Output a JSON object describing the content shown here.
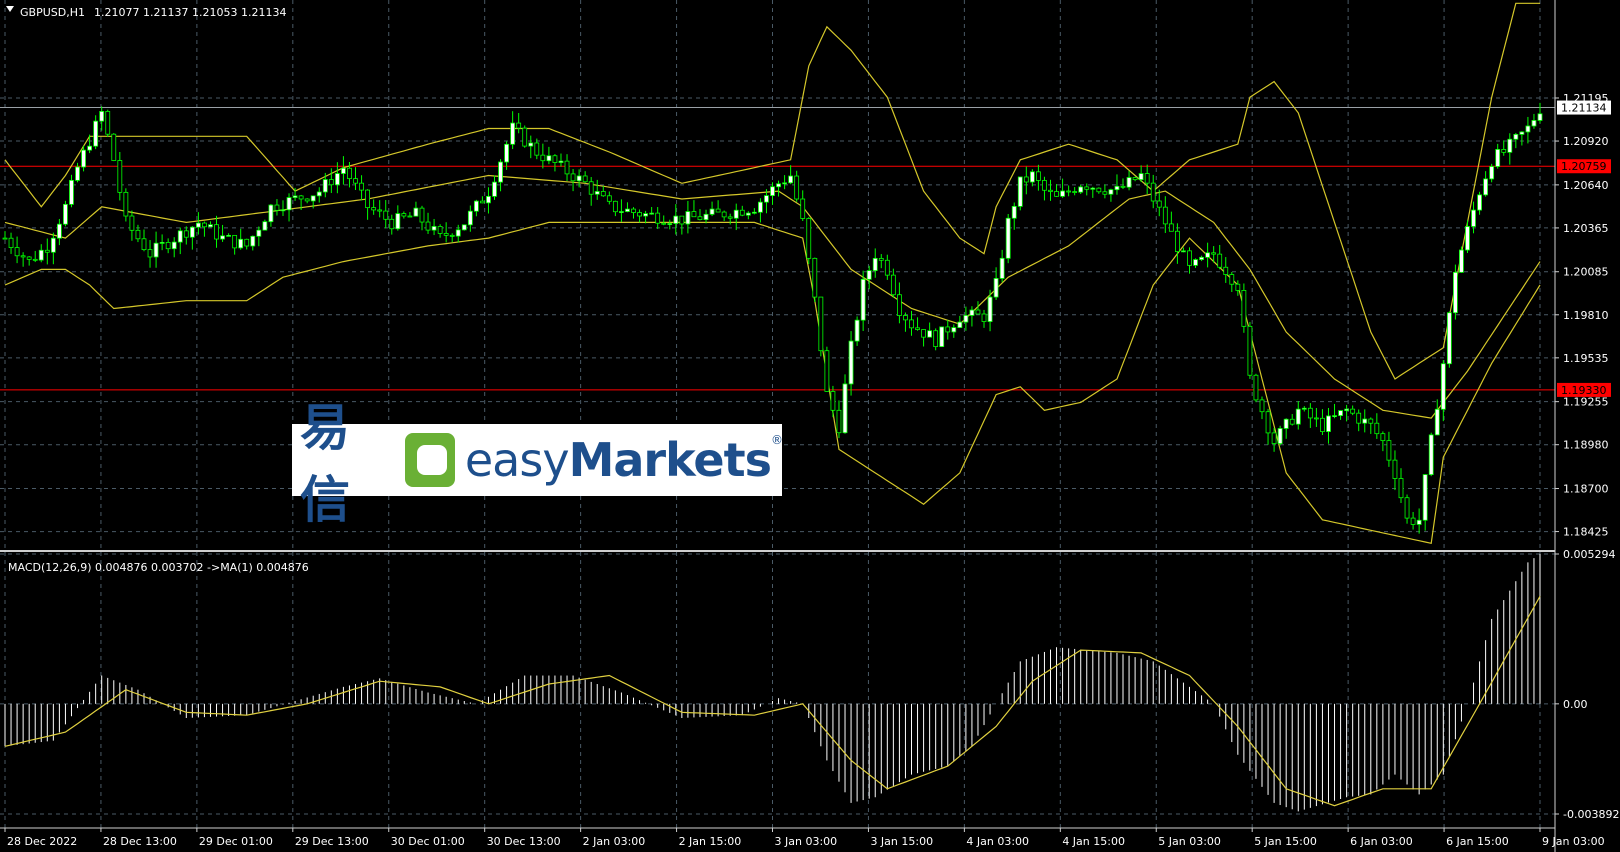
{
  "header": {
    "symbol": "GBPUSD,H1",
    "ohlc": "1.21077 1.21137 1.21053 1.21134"
  },
  "macd_header": "MACD(12,26,9) 0.004876 0.003702  ->MA(1) 0.004876",
  "logo": {
    "cn": "易信",
    "en_light": "easy",
    "en_bold": "Markets",
    "reg": "®"
  },
  "colors": {
    "background": "#000000",
    "grid": "#4a5a66",
    "bull_candle": "#ffffff",
    "bear_candle": "#000000",
    "wick": "#00ff00",
    "bands": "#d4c72a",
    "level_line": "#ff0000",
    "macd_hist": "#ffffff",
    "macd_signal": "#e0d040",
    "text": "#ffffff"
  },
  "chart_data": [
    {
      "type": "candlestick",
      "symbol": "GBPUSD",
      "timeframe": "H1",
      "ylim": [
        1.1832,
        1.2177
      ],
      "yticks": [
        "1.21195",
        "1.20920",
        "1.20640",
        "1.20365",
        "1.20085",
        "1.19810",
        "1.19535",
        "1.19255",
        "1.18980",
        "1.18700",
        "1.18425"
      ],
      "current_price": "1.21134",
      "levels": [
        {
          "value": 1.20759,
          "label": "1.20759"
        },
        {
          "value": 1.1933,
          "label": "1.19330"
        }
      ],
      "x_labels": [
        "28 Dec 2022",
        "28 Dec 13:00",
        "29 Dec 01:00",
        "29 Dec 13:00",
        "30 Dec 01:00",
        "30 Dec 13:00",
        "2 Jan 03:00",
        "2 Jan 15:00",
        "3 Jan 03:00",
        "3 Jan 15:00",
        "4 Jan 03:00",
        "4 Jan 15:00",
        "5 Jan 03:00",
        "5 Jan 15:00",
        "6 Jan 03:00",
        "6 Jan 15:00",
        "9 Jan 03:00"
      ],
      "close_path": [
        [
          0,
          1.203
        ],
        [
          4,
          1.2015
        ],
        [
          7,
          1.2025
        ],
        [
          10,
          1.205
        ],
        [
          12,
          1.2075
        ],
        [
          16,
          1.211
        ],
        [
          18,
          1.208
        ],
        [
          20,
          1.204
        ],
        [
          24,
          1.202
        ],
        [
          28,
          1.203
        ],
        [
          32,
          1.204
        ],
        [
          36,
          1.203
        ],
        [
          40,
          1.2025
        ],
        [
          44,
          1.205
        ],
        [
          48,
          1.2055
        ],
        [
          52,
          1.206
        ],
        [
          56,
          1.2075
        ],
        [
          60,
          1.205
        ],
        [
          64,
          1.204
        ],
        [
          68,
          1.2045
        ],
        [
          72,
          1.203
        ],
        [
          76,
          1.204
        ],
        [
          80,
          1.206
        ],
        [
          84,
          1.21
        ],
        [
          88,
          1.2085
        ],
        [
          92,
          1.2075
        ],
        [
          96,
          1.2065
        ],
        [
          100,
          1.205
        ],
        [
          106,
          1.2045
        ],
        [
          112,
          1.2042
        ],
        [
          118,
          1.2045
        ],
        [
          124,
          1.205
        ],
        [
          128,
          1.2065
        ],
        [
          130,
          1.207
        ],
        [
          132,
          1.204
        ],
        [
          134,
          1.199
        ],
        [
          136,
          1.193
        ],
        [
          138,
          1.191
        ],
        [
          140,
          1.196
        ],
        [
          142,
          1.2
        ],
        [
          144,
          1.202
        ],
        [
          146,
          1.201
        ],
        [
          148,
          1.1985
        ],
        [
          150,
          1.1975
        ],
        [
          154,
          1.1965
        ],
        [
          158,
          1.198
        ],
        [
          162,
          1.198
        ],
        [
          164,
          1.2
        ],
        [
          166,
          1.204
        ],
        [
          168,
          1.2065
        ],
        [
          170,
          1.207
        ],
        [
          172,
          1.206
        ],
        [
          174,
          1.2055
        ],
        [
          178,
          1.2065
        ],
        [
          184,
          1.206
        ],
        [
          188,
          1.207
        ],
        [
          190,
          1.2055
        ],
        [
          192,
          1.204
        ],
        [
          196,
          1.201
        ],
        [
          200,
          1.202
        ],
        [
          204,
          1.2
        ],
        [
          206,
          1.194
        ],
        [
          208,
          1.192
        ],
        [
          210,
          1.19
        ],
        [
          214,
          1.192
        ],
        [
          218,
          1.191
        ],
        [
          222,
          1.192
        ],
        [
          226,
          1.191
        ],
        [
          228,
          1.19
        ],
        [
          230,
          1.188
        ],
        [
          232,
          1.185
        ],
        [
          234,
          1.185
        ],
        [
          236,
          1.19
        ],
        [
          238,
          1.195
        ],
        [
          240,
          1.201
        ],
        [
          244,
          1.206
        ],
        [
          246,
          1.208
        ],
        [
          248,
          1.2085
        ],
        [
          252,
          1.21
        ],
        [
          254,
          1.2113
        ]
      ],
      "bollinger_upper": [
        [
          0,
          1.208
        ],
        [
          6,
          1.205
        ],
        [
          10,
          1.207
        ],
        [
          14,
          1.2095
        ],
        [
          40,
          1.2095
        ],
        [
          48,
          1.206
        ],
        [
          56,
          1.2075
        ],
        [
          70,
          1.209
        ],
        [
          80,
          1.21
        ],
        [
          90,
          1.21
        ],
        [
          100,
          1.2085
        ],
        [
          112,
          1.2065
        ],
        [
          124,
          1.2075
        ],
        [
          130,
          1.208
        ],
        [
          133,
          1.214
        ],
        [
          136,
          1.2165
        ],
        [
          140,
          1.215
        ],
        [
          146,
          1.212
        ],
        [
          152,
          1.206
        ],
        [
          158,
          1.203
        ],
        [
          162,
          1.202
        ],
        [
          164,
          1.205
        ],
        [
          168,
          1.208
        ],
        [
          176,
          1.209
        ],
        [
          184,
          1.208
        ],
        [
          190,
          1.206
        ],
        [
          196,
          1.208
        ],
        [
          204,
          1.209
        ],
        [
          206,
          1.212
        ],
        [
          210,
          1.213
        ],
        [
          214,
          1.211
        ],
        [
          220,
          1.204
        ],
        [
          226,
          1.197
        ],
        [
          230,
          1.194
        ],
        [
          234,
          1.195
        ],
        [
          238,
          1.196
        ],
        [
          242,
          1.204
        ],
        [
          246,
          1.212
        ],
        [
          250,
          1.218
        ]
      ],
      "bollinger_middle": [
        [
          0,
          1.204
        ],
        [
          10,
          1.203
        ],
        [
          16,
          1.205
        ],
        [
          30,
          1.204
        ],
        [
          40,
          1.2045
        ],
        [
          60,
          1.2055
        ],
        [
          80,
          1.207
        ],
        [
          96,
          1.2065
        ],
        [
          112,
          1.2055
        ],
        [
          128,
          1.206
        ],
        [
          132,
          1.205
        ],
        [
          140,
          1.201
        ],
        [
          150,
          1.1985
        ],
        [
          158,
          1.1975
        ],
        [
          166,
          1.2005
        ],
        [
          176,
          1.2025
        ],
        [
          186,
          1.2055
        ],
        [
          192,
          1.206
        ],
        [
          200,
          1.204
        ],
        [
          206,
          1.201
        ],
        [
          212,
          1.197
        ],
        [
          220,
          1.194
        ],
        [
          228,
          1.192
        ],
        [
          236,
          1.1915
        ],
        [
          242,
          1.1945
        ],
        [
          254,
          1.2015
        ]
      ],
      "bollinger_lower": [
        [
          0,
          1.2
        ],
        [
          6,
          1.201
        ],
        [
          10,
          1.201
        ],
        [
          14,
          1.2
        ],
        [
          18,
          1.1985
        ],
        [
          30,
          1.199
        ],
        [
          40,
          1.199
        ],
        [
          46,
          1.2005
        ],
        [
          56,
          1.2015
        ],
        [
          70,
          1.2025
        ],
        [
          80,
          1.203
        ],
        [
          90,
          1.204
        ],
        [
          100,
          1.204
        ],
        [
          112,
          1.204
        ],
        [
          124,
          1.204
        ],
        [
          132,
          1.203
        ],
        [
          134,
          1.199
        ],
        [
          138,
          1.1895
        ],
        [
          146,
          1.1875
        ],
        [
          152,
          1.186
        ],
        [
          158,
          1.188
        ],
        [
          164,
          1.193
        ],
        [
          168,
          1.1935
        ],
        [
          172,
          1.192
        ],
        [
          178,
          1.1925
        ],
        [
          184,
          1.194
        ],
        [
          190,
          1.2
        ],
        [
          196,
          1.203
        ],
        [
          204,
          1.2
        ],
        [
          208,
          1.194
        ],
        [
          212,
          1.188
        ],
        [
          218,
          1.185
        ],
        [
          224,
          1.1845
        ],
        [
          230,
          1.184
        ],
        [
          236,
          1.1835
        ],
        [
          238,
          1.189
        ],
        [
          246,
          1.195
        ],
        [
          254,
          1.2
        ]
      ]
    },
    {
      "type": "bar",
      "name": "MACD(12,26,9)",
      "ylim": [
        -0.003892,
        0.005294
      ],
      "yticks": [
        "0.005294",
        "0.00",
        "-0.003892"
      ],
      "histogram_path": [
        [
          0,
          -0.0015
        ],
        [
          8,
          -0.0013
        ],
        [
          16,
          0.001
        ],
        [
          22,
          0.0005
        ],
        [
          30,
          -0.0005
        ],
        [
          40,
          -0.0004
        ],
        [
          48,
          0.0001
        ],
        [
          56,
          0.0006
        ],
        [
          62,
          0.0009
        ],
        [
          70,
          0.0004
        ],
        [
          78,
          0.0
        ],
        [
          86,
          0.001
        ],
        [
          94,
          0.001
        ],
        [
          102,
          0.0004
        ],
        [
          112,
          -0.0005
        ],
        [
          122,
          -0.0004
        ],
        [
          128,
          0.0002
        ],
        [
          132,
          0.0
        ],
        [
          136,
          -0.002
        ],
        [
          140,
          -0.0035
        ],
        [
          144,
          -0.0033
        ],
        [
          150,
          -0.0025
        ],
        [
          156,
          -0.0022
        ],
        [
          160,
          -0.0015
        ],
        [
          164,
          0.0
        ],
        [
          168,
          0.0015
        ],
        [
          174,
          0.002
        ],
        [
          184,
          0.0018
        ],
        [
          190,
          0.0015
        ],
        [
          196,
          0.0006
        ],
        [
          200,
          0.0
        ],
        [
          204,
          -0.0018
        ],
        [
          210,
          -0.0035
        ],
        [
          214,
          -0.0038
        ],
        [
          222,
          -0.0033
        ],
        [
          226,
          -0.0032
        ],
        [
          230,
          -0.0025
        ],
        [
          234,
          -0.0032
        ],
        [
          238,
          -0.0025
        ],
        [
          242,
          0.0
        ],
        [
          246,
          0.003
        ],
        [
          252,
          0.005
        ],
        [
          254,
          0.0053
        ]
      ],
      "signal_path": [
        [
          0,
          -0.0015
        ],
        [
          10,
          -0.001
        ],
        [
          20,
          0.0005
        ],
        [
          30,
          -0.0003
        ],
        [
          40,
          -0.0004
        ],
        [
          50,
          0.0
        ],
        [
          62,
          0.0008
        ],
        [
          72,
          0.0006
        ],
        [
          80,
          0.0
        ],
        [
          90,
          0.0007
        ],
        [
          100,
          0.001
        ],
        [
          112,
          -0.0003
        ],
        [
          124,
          -0.0004
        ],
        [
          132,
          0.0
        ],
        [
          140,
          -0.002
        ],
        [
          146,
          -0.003
        ],
        [
          156,
          -0.0022
        ],
        [
          164,
          -0.0008
        ],
        [
          170,
          0.0008
        ],
        [
          178,
          0.0019
        ],
        [
          188,
          0.0018
        ],
        [
          196,
          0.001
        ],
        [
          204,
          -0.0008
        ],
        [
          212,
          -0.003
        ],
        [
          220,
          -0.0036
        ],
        [
          228,
          -0.003
        ],
        [
          236,
          -0.003
        ],
        [
          244,
          0.0
        ],
        [
          254,
          0.0038
        ]
      ]
    }
  ]
}
